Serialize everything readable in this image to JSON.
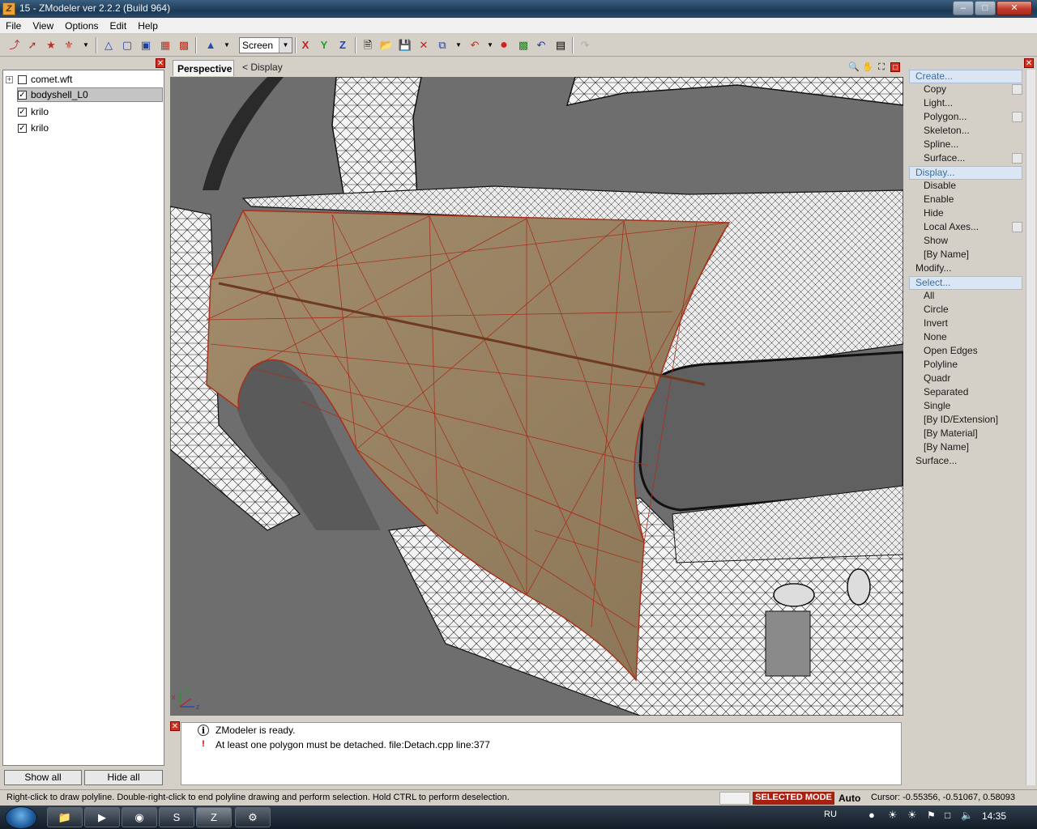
{
  "window": {
    "title": "15 - ZModeler ver 2.2.2 (Build 964)",
    "app_icon": "Z",
    "buttons": [
      "minimize-icon",
      "maximize-icon",
      "close-icon"
    ]
  },
  "menu": [
    "File",
    "View",
    "Options",
    "Edit",
    "Help"
  ],
  "toolbar": {
    "coord_mode": "Screen",
    "axis_x": "X",
    "axis_y": "Y",
    "axis_z": "Z"
  },
  "tree": {
    "items": [
      {
        "label": "comet.wft",
        "checked": false,
        "expandable": true
      },
      {
        "label": "bodyshell_L0",
        "checked": true,
        "selected": true
      },
      {
        "label": "krilo",
        "checked": true
      },
      {
        "label": "krilo",
        "checked": true
      }
    ],
    "show_all": "Show all",
    "hide_all": "Hide all"
  },
  "viewport": {
    "tab": "Perspective",
    "crumb": "<  Display",
    "axis_labels": {
      "x": "x",
      "y": "y",
      "z": "z"
    }
  },
  "log": [
    {
      "type": "info",
      "text": "ZModeler is ready."
    },
    {
      "type": "warning",
      "text": "At least one polygon must be detached. file:Detach.cpp line:377"
    }
  ],
  "commands": [
    {
      "label": "Create...",
      "kind": "group",
      "highlight": true
    },
    {
      "label": "Copy",
      "kind": "sub",
      "option": true
    },
    {
      "label": "Light...",
      "kind": "sub"
    },
    {
      "label": "Polygon...",
      "kind": "sub",
      "option": true
    },
    {
      "label": "Skeleton...",
      "kind": "sub"
    },
    {
      "label": "Spline...",
      "kind": "sub"
    },
    {
      "label": "Surface...",
      "kind": "sub",
      "option": true
    },
    {
      "label": "Display...",
      "kind": "group",
      "highlight": true
    },
    {
      "label": "Disable",
      "kind": "sub"
    },
    {
      "label": "Enable",
      "kind": "sub"
    },
    {
      "label": "Hide",
      "kind": "sub"
    },
    {
      "label": "Local Axes...",
      "kind": "sub",
      "option": true
    },
    {
      "label": "Show",
      "kind": "sub"
    },
    {
      "label": "[By Name]",
      "kind": "sub"
    },
    {
      "label": "Modify...",
      "kind": "group"
    },
    {
      "label": "Select...",
      "kind": "group",
      "highlight": true
    },
    {
      "label": "All",
      "kind": "sub"
    },
    {
      "label": "Circle",
      "kind": "sub"
    },
    {
      "label": "Invert",
      "kind": "sub"
    },
    {
      "label": "None",
      "kind": "sub"
    },
    {
      "label": "Open Edges",
      "kind": "sub"
    },
    {
      "label": "Polyline",
      "kind": "sub"
    },
    {
      "label": "Quadr",
      "kind": "sub"
    },
    {
      "label": "Separated",
      "kind": "sub"
    },
    {
      "label": "Single",
      "kind": "sub"
    },
    {
      "label": "[By ID/Extension]",
      "kind": "sub"
    },
    {
      "label": "[By Material]",
      "kind": "sub"
    },
    {
      "label": "[By Name]",
      "kind": "sub"
    },
    {
      "label": "Surface...",
      "kind": "group"
    }
  ],
  "status": {
    "hint": "Right-click to draw polyline. Double-right-click to end polyline drawing and perform selection. Hold CTRL to perform deselection.",
    "mode": "SELECTED MODE",
    "auto": "Auto",
    "cursor": "Cursor: -0.55356, -0.51067, 0.58093"
  },
  "taskbar": {
    "language": "RU",
    "clock": "14:35"
  },
  "colors": {
    "selection_fill": "#9c8566",
    "selection_edges": "#a8301c",
    "mesh_edges": "#1e1e1e",
    "mode_badge": "#a82010"
  }
}
